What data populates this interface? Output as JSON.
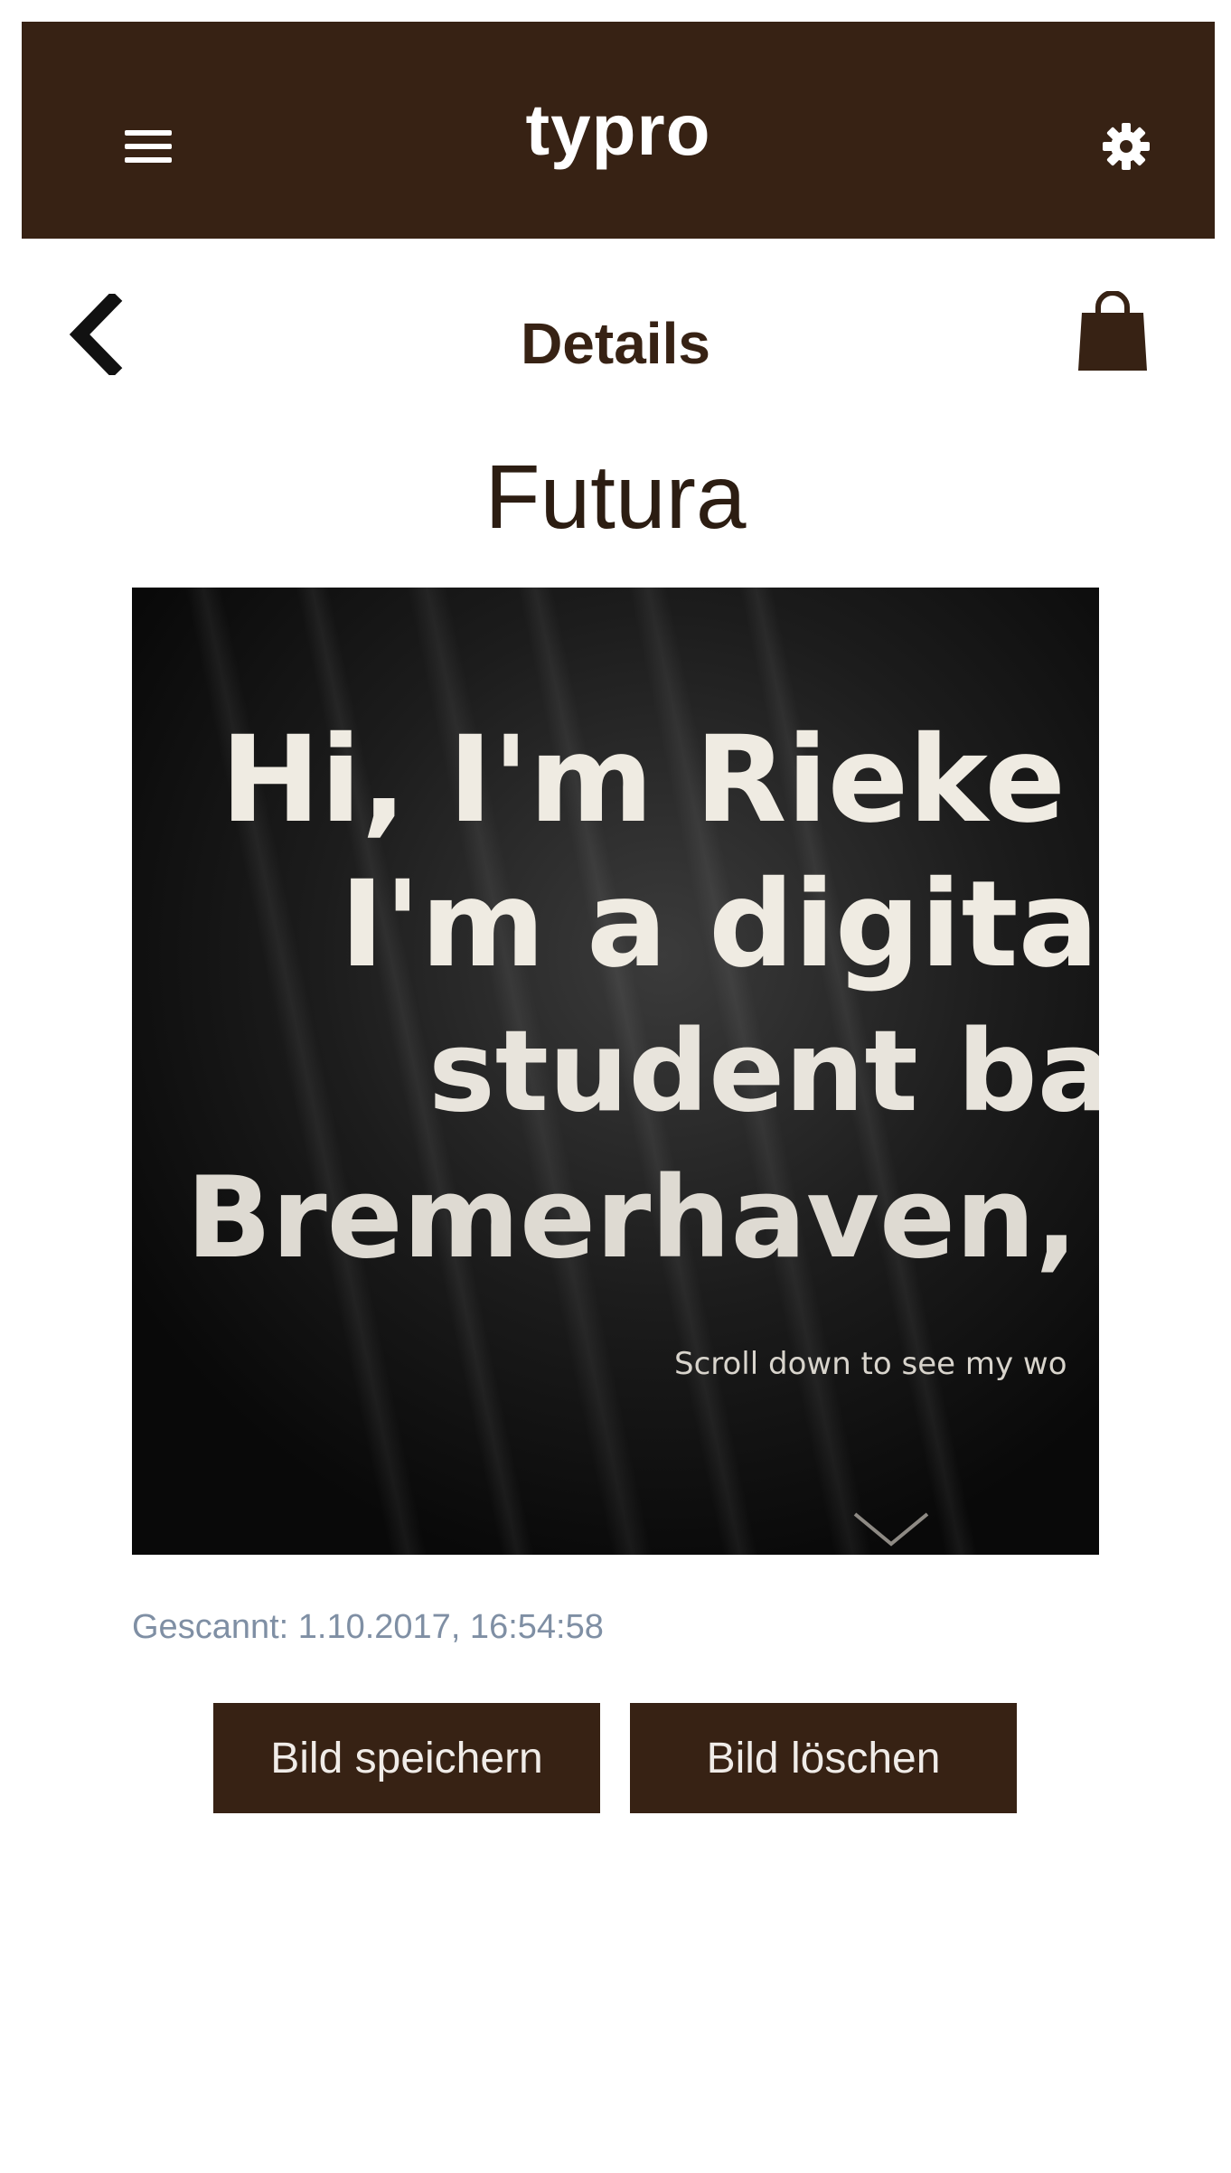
{
  "header": {
    "app_title": "typro",
    "menu_icon": "hamburger-menu-icon",
    "settings_icon": "gear-icon",
    "background_color": "#372214"
  },
  "subheader": {
    "page_title": "Details",
    "back_icon": "chevron-left-icon",
    "bag_icon": "shopping-bag-icon"
  },
  "detail": {
    "font_name": "Futura",
    "image": {
      "lines": [
        "Hi, I'm Rieke",
        "I'm a digital",
        "student bas",
        "Bremerhaven, G"
      ],
      "caption": "Scroll down to see my wo"
    },
    "scanned_label": "Gescannt: 1.10.2017, 16:54:58"
  },
  "actions": {
    "save_label": "Bild speichern",
    "delete_label": "Bild löschen"
  }
}
